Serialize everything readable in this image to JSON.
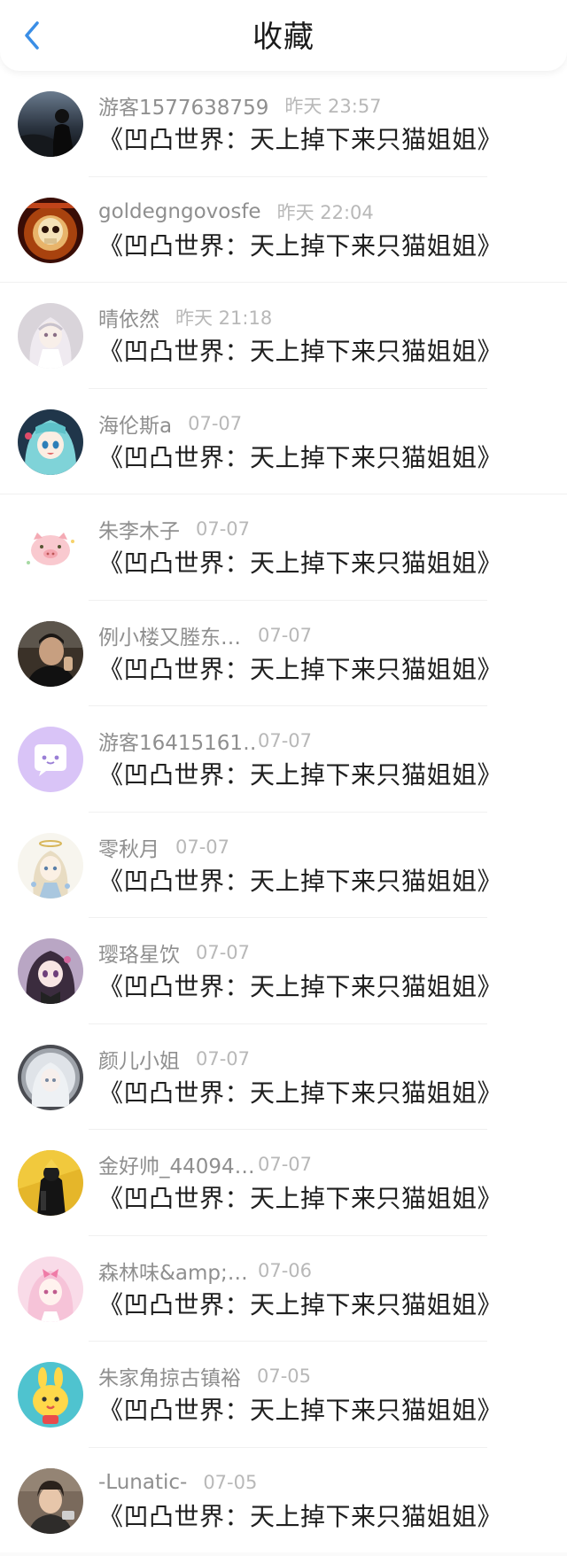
{
  "header": {
    "title": "收藏"
  },
  "colors": {
    "accent": "#3a8ee6",
    "name_text": "#8f8f8f",
    "time_text": "#b8b8b8",
    "work_text": "#1f1f1f"
  },
  "items": [
    {
      "name": "游客1577638759",
      "time": "昨天 23:57",
      "work": "《凹凸世界：天上掉下来只猫姐姐》",
      "avatar": "dark-silhouette"
    },
    {
      "name": "goldegngovosfe",
      "time": "昨天 22:04",
      "work": "《凹凸世界：天上掉下来只猫姐姐》",
      "avatar": "golden-skull"
    },
    {
      "name": "晴依然",
      "time": "昨天 21:18",
      "work": "《凹凸世界：天上掉下来只猫姐姐》",
      "avatar": "white-hair-girl"
    },
    {
      "name": "海伦斯a",
      "time": "07-07",
      "work": "《凹凸世界：天上掉下来只猫姐姐》",
      "avatar": "teal-hair-girl"
    },
    {
      "name": "朱李木子",
      "time": "07-07",
      "work": "《凹凸世界：天上掉下来只猫姐姐》",
      "avatar": "pink-pig"
    },
    {
      "name": "例小楼又塍东…",
      "time": "07-07",
      "work": "《凹凸世界：天上掉下来只猫姐姐》",
      "avatar": "man-photo"
    },
    {
      "name": "游客16415161…",
      "time": "07-07",
      "work": "《凹凸世界：天上掉下来只猫姐姐》",
      "avatar": "purple-chat"
    },
    {
      "name": "零秋月",
      "time": "07-07",
      "work": "《凹凸世界：天上掉下来只猫姐姐》",
      "avatar": "angel-girl"
    },
    {
      "name": "璎珞星饮",
      "time": "07-07",
      "work": "《凹凸世界：天上掉下来只猫姐姐》",
      "avatar": "dark-hair-girl"
    },
    {
      "name": "颜儿小姐",
      "time": "07-07",
      "work": "《凹凸世界：天上掉下来只猫姐姐》",
      "avatar": "silver-hair-girl"
    },
    {
      "name": "金好帅_44094…",
      "time": "07-07",
      "work": "《凹凸世界：天上掉下来只猫姐姐》",
      "avatar": "black-yellow-figure"
    },
    {
      "name": "森林味&amp;…",
      "time": "07-06",
      "work": "《凹凸世界：天上掉下来只猫姐姐》",
      "avatar": "pink-bow-girl"
    },
    {
      "name": "朱家角掠古镇裕",
      "time": "07-05",
      "work": "《凹凸世界：天上掉下来只猫姐姐》",
      "avatar": "yellow-bunny"
    },
    {
      "name": "-Lunatic-",
      "time": "07-05",
      "work": "《凹凸世界：天上掉下来只猫姐姐》",
      "avatar": "boy-photo"
    }
  ]
}
